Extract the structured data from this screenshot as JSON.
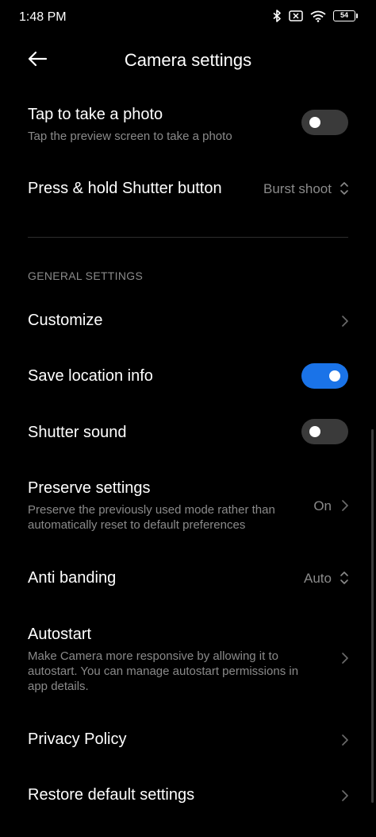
{
  "status_bar": {
    "time": "1:48 PM",
    "battery_level": "54"
  },
  "header": {
    "title": "Camera settings"
  },
  "rows": {
    "tap_photo": {
      "title": "Tap to take a photo",
      "subtitle": "Tap the preview screen to take a photo",
      "enabled": false
    },
    "press_hold": {
      "title": "Press & hold Shutter button",
      "value": "Burst shoot"
    },
    "customize": {
      "title": "Customize"
    },
    "save_location": {
      "title": "Save location info",
      "enabled": true
    },
    "shutter_sound": {
      "title": "Shutter sound",
      "enabled": false
    },
    "preserve": {
      "title": "Preserve settings",
      "subtitle": "Preserve the previously used mode rather than automatically reset to default preferences",
      "value": "On"
    },
    "anti_banding": {
      "title": "Anti banding",
      "value": "Auto"
    },
    "autostart": {
      "title": "Autostart",
      "subtitle": "Make Camera more responsive by allowing it to autostart. You can manage autostart permissions in app details."
    },
    "privacy": {
      "title": "Privacy Policy"
    },
    "restore": {
      "title": "Restore default settings"
    }
  },
  "sections": {
    "general": "GENERAL SETTINGS"
  },
  "colors": {
    "background": "#000000",
    "toggle_on": "#1a73e8",
    "toggle_off": "#3a3a3a",
    "secondary_text": "#8a8a8a"
  },
  "icons": {
    "back": "arrow-left-icon",
    "chevron": "chevron-right-icon",
    "selector": "up-down-chevron-icon",
    "bluetooth": "bluetooth-icon",
    "sim": "sim-no-signal-icon",
    "wifi": "wifi-icon",
    "battery": "battery-icon"
  }
}
